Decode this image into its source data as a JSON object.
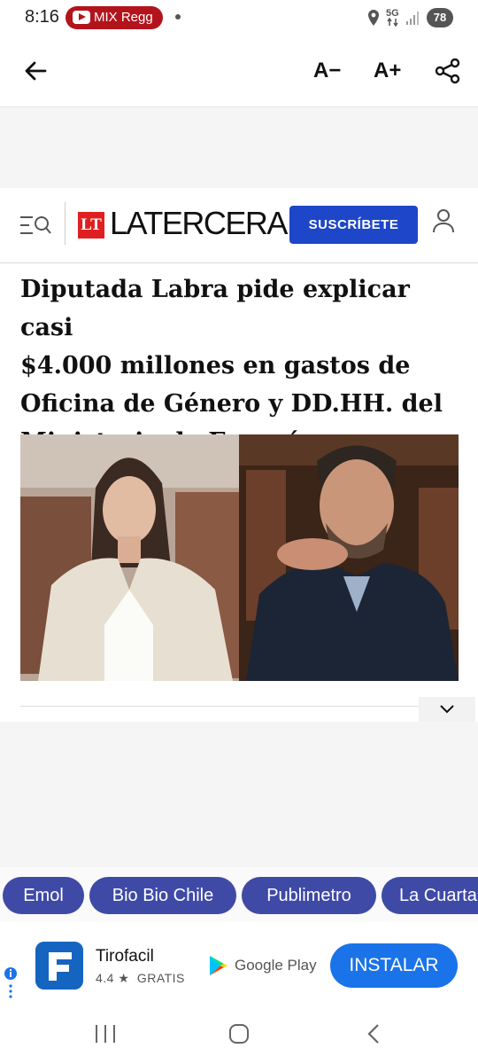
{
  "status_bar": {
    "time": "8:16",
    "media_label": "MIX Regg",
    "network": "5G",
    "battery": "78"
  },
  "toolbar": {
    "decrease_font": "A−",
    "increase_font": "A+"
  },
  "site": {
    "logo_mark": "LT",
    "logo_name": "LATERCERA",
    "subscribe_label": "SUSCRÍBETE"
  },
  "article": {
    "headline_lines": [
      "Diputada Labra pide explicar casi",
      "$4.000 millones en gastos de",
      "Oficina de Género y DD.HH. del",
      "Ministerio de Energía"
    ]
  },
  "chips": [
    "Emol",
    "Bio Bio Chile",
    "Publimetro",
    "La Cuarta"
  ],
  "ad": {
    "app_name": "Tirofacil",
    "rating": "4.4",
    "price": "GRATIS",
    "store": "Google Play",
    "install_label": "INSTALAR"
  },
  "colors": {
    "brand_red": "#e02020",
    "subscribe_blue": "#1e46c8",
    "chip_bg": "#3f4aa6",
    "install_blue": "#1a73e8"
  }
}
